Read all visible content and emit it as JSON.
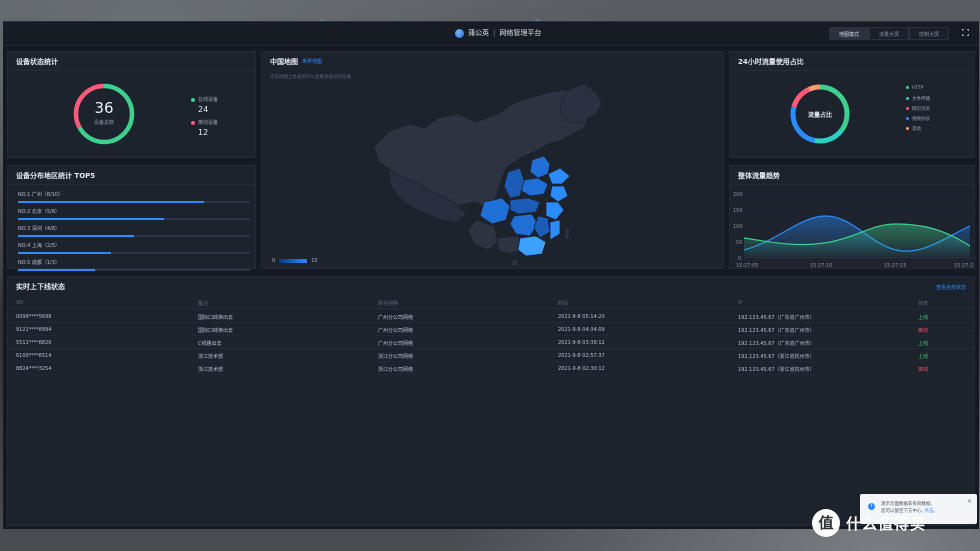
{
  "header": {
    "brand": "蒲公英",
    "product": "网络管理平台",
    "modes": [
      "地图模式",
      "流量大屏",
      "控制大屏"
    ]
  },
  "device_status": {
    "title": "设备状态统计",
    "total": "36",
    "total_label": "设备总数",
    "online_label": "在线设备",
    "online_value": "24",
    "offline_label": "离线设备",
    "offline_value": "12",
    "colors": {
      "online": "#3fcf8e",
      "offline": "#ff5a78"
    }
  },
  "top5": {
    "title": "设备分布地区统计 TOP5",
    "items": [
      {
        "label": "NO.1  广州（8/10）",
        "fill": 0.8
      },
      {
        "label": "NO.2  北京（5/8）",
        "fill": 0.63
      },
      {
        "label": "NO.3  深圳（4/8）",
        "fill": 0.5
      },
      {
        "label": "NO.4  上海（2/5）",
        "fill": 0.4
      },
      {
        "label": "NO.5  成都（1/3）",
        "fill": 0.33
      }
    ]
  },
  "map": {
    "title": "中国地图",
    "link": "世界地图",
    "subtitle": "点击地图上各省的可以查看该省份的设备",
    "scale_min": "0",
    "scale_max": "10",
    "accent": "#2a8cff"
  },
  "traffic_share": {
    "title": "24小时流量使用占比",
    "center_label": "流量占比",
    "legend": [
      {
        "label": "HTTP",
        "color": "#3fcf8e"
      },
      {
        "label": "文件传输",
        "color": "#2ad1c4"
      },
      {
        "label": "网页浏览",
        "color": "#ff5a78"
      },
      {
        "label": "视频协议",
        "color": "#2a8cff"
      },
      {
        "label": "其他",
        "color": "#ff9a6a"
      }
    ]
  },
  "trend": {
    "title": "整体流量趋势",
    "y_ticks": [
      "200",
      "150",
      "100",
      "50",
      "0"
    ],
    "x_ticks": [
      "15:27:05",
      "15:27:10",
      "15:27:15",
      "15:27:2"
    ]
  },
  "table": {
    "title": "实时上下线状态",
    "link": "查看全部状态",
    "headers": [
      "SN",
      "备注",
      "所在网络",
      "时间",
      "IP",
      "状态"
    ],
    "rows": [
      [
        "0099****5698",
        "国际口转换出去",
        "广州分公司网络",
        "2021-9-8 05:14:20",
        "192.123.45.67（广东省广州市）",
        "上线"
      ],
      [
        "9121****8994",
        "国际口转换出去",
        "广州分公司网络",
        "2021-9-8 04:34:09",
        "192.123.45.67（广东省广州市）",
        "离线"
      ],
      [
        "5511****8820",
        "C线路出去",
        "广州分公司网络",
        "2021-9-8 03:39:12",
        "192.123.45.67（广东省广州市）",
        "上线"
      ],
      [
        "6100****6514",
        "浙江技术部",
        "浙江分公司网络",
        "2021-9-8 02:57:37",
        "192.123.45.67（浙江省杭州市）",
        "上线"
      ],
      [
        "8824****3254",
        "浙江技术部",
        "浙江分公司网络",
        "2021-9-8 02:30:12",
        "192.123.45.67（浙江省杭州市）",
        "离线"
      ]
    ]
  },
  "toast": {
    "line1": "演示页面数据非有效数据,",
    "line2": "您可以留空下方中心,",
    "link": "点击。",
    "close": "×"
  },
  "watermark": {
    "logo": "值",
    "text": "什么值得买"
  }
}
